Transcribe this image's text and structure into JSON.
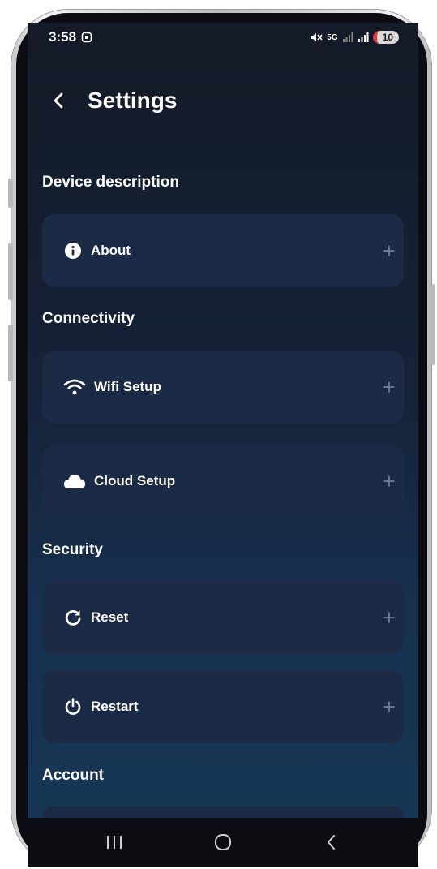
{
  "status": {
    "time": "3:58",
    "network": "5G",
    "battery": "10"
  },
  "header": {
    "title": "Settings"
  },
  "sections": [
    {
      "title": "Device description"
    },
    {
      "title": "Connectivity"
    },
    {
      "title": "Security"
    },
    {
      "title": "Account"
    }
  ],
  "items": {
    "about": {
      "label": "About",
      "icon": "info-icon"
    },
    "wifi": {
      "label": "Wifi Setup",
      "icon": "wifi-icon"
    },
    "cloud": {
      "label": "Cloud Setup",
      "icon": "cloud-icon"
    },
    "reset": {
      "label": "Reset",
      "icon": "refresh-icon"
    },
    "restart": {
      "label": "Restart",
      "icon": "power-icon"
    }
  },
  "expand_symbol": "+",
  "colors": {
    "card": "#1c2b45",
    "text": "#ffffff",
    "plus": "#6d7a8f"
  }
}
